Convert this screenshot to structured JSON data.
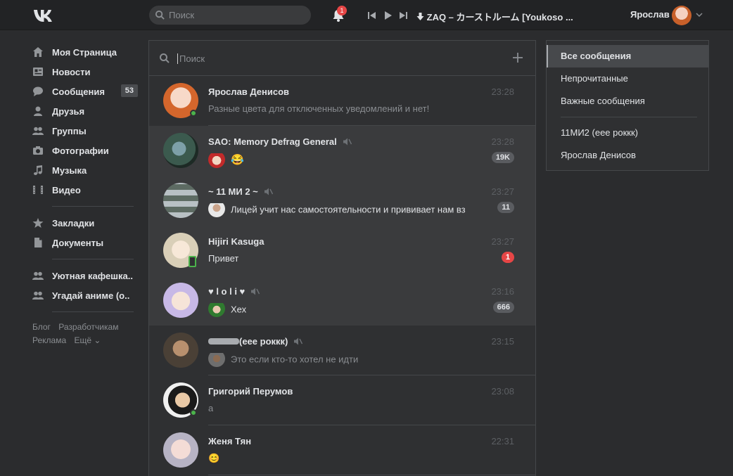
{
  "topbar": {
    "search_placeholder": "Поиск",
    "notifications_count": "1",
    "track": "ZAQ – カーストルーム [Youkoso ...",
    "user_name": "Ярослав"
  },
  "nav": {
    "items": [
      {
        "label": "Моя Страница",
        "icon": "home-icon"
      },
      {
        "label": "Новости",
        "icon": "news-icon"
      },
      {
        "label": "Сообщения",
        "icon": "messages-icon",
        "count": "53"
      },
      {
        "label": "Друзья",
        "icon": "friends-icon"
      },
      {
        "label": "Группы",
        "icon": "groups-icon"
      },
      {
        "label": "Фотографии",
        "icon": "camera-icon"
      },
      {
        "label": "Музыка",
        "icon": "music-icon"
      },
      {
        "label": "Видео",
        "icon": "video-icon"
      }
    ],
    "items2": [
      {
        "label": "Закладки",
        "icon": "star-icon"
      },
      {
        "label": "Документы",
        "icon": "document-icon"
      }
    ],
    "items3": [
      {
        "label": "Уютная кафешка..",
        "icon": "group-icon"
      },
      {
        "label": "Угадай аниме (о..",
        "icon": "group-icon"
      }
    ],
    "footer": [
      "Блог",
      "Разработчикам",
      "Реклама",
      "Ещё ⌄"
    ]
  },
  "messages": {
    "search_placeholder": "Поиск",
    "conversations": [
      {
        "name": "Ярослав Денисов",
        "time": "23:28",
        "text": "Разные цвета для отключенных уведомлений и нет!",
        "unread": false,
        "muted": false,
        "status": "online"
      },
      {
        "name": "SAO: Memory Defrag General",
        "time": "23:28",
        "text": "😂",
        "unread": true,
        "muted": true,
        "badge": "19K"
      },
      {
        "name": "~ 11 МИ 2 ~",
        "time": "23:27",
        "text": "Лицей учит нас самостоятельности и прививает нам вз",
        "unread": true,
        "muted": true,
        "badge": "11"
      },
      {
        "name": "Hijiri Kasuga",
        "time": "23:27",
        "text": "Привет",
        "unread": true,
        "muted": false,
        "badge": "1",
        "badge_red": true,
        "status": "mobile"
      },
      {
        "name": "♥ l o l i ♥",
        "time": "23:16",
        "text": "Хех",
        "unread": true,
        "muted": true,
        "badge": "666"
      },
      {
        "name": "(еее роккк)",
        "time": "23:15",
        "text": "Это если кто-то хотел не идти",
        "unread": false,
        "muted": true
      },
      {
        "name": "Григорий Перумов",
        "time": "23:08",
        "text": "а",
        "unread": false,
        "muted": false,
        "status": "online"
      },
      {
        "name": "Женя Тян",
        "time": "22:31",
        "text": "😊",
        "unread": false,
        "muted": false
      }
    ]
  },
  "filters": {
    "items": [
      "Все сообщения",
      "Непрочитанные",
      "Важные сообщения"
    ],
    "chats": [
      "11МИ2 (еее роккк)",
      "Ярослав Денисов"
    ]
  },
  "colors": {
    "background": "#2b2c2e",
    "topbar": "#222325",
    "panel": "#2f3032",
    "unread_row": "#3a3b3d",
    "badge_red": "#e64646",
    "online": "#4bb34b"
  }
}
